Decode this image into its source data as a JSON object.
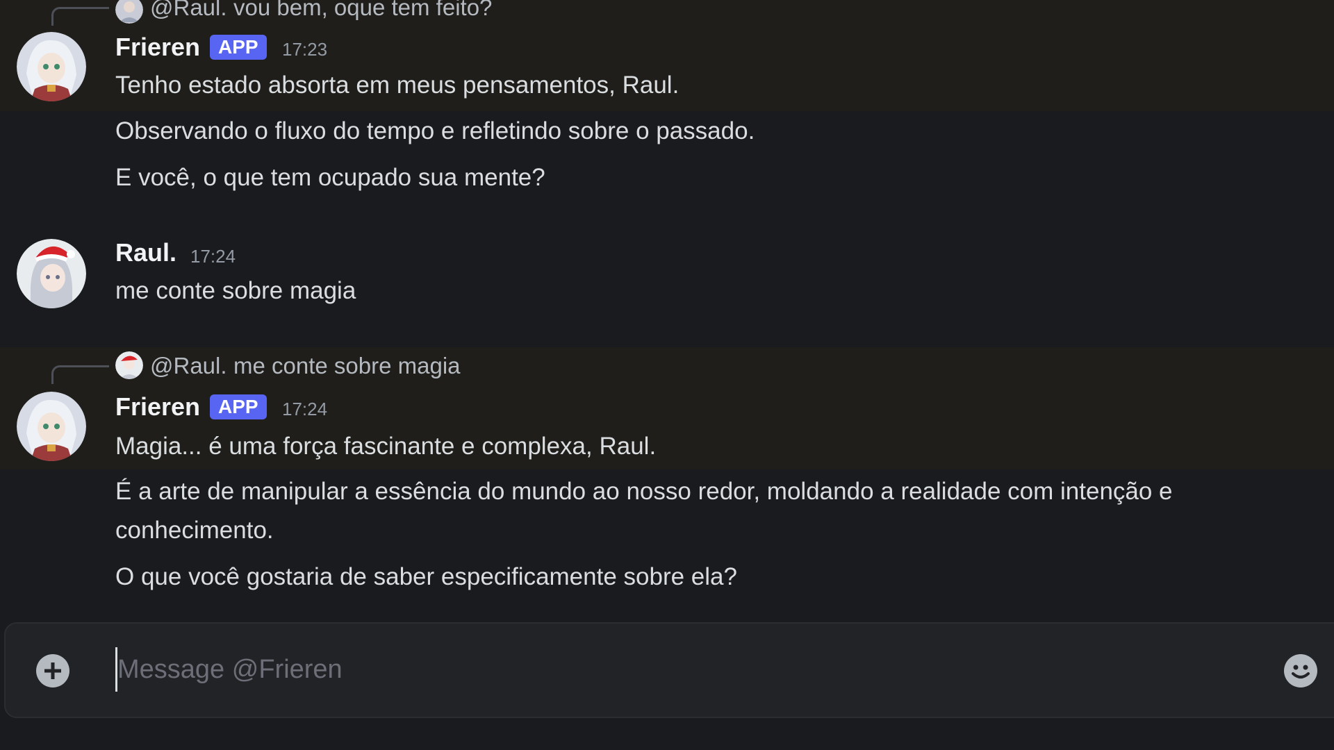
{
  "colors": {
    "background": "#1a1b1e",
    "highlight": "#1f1e1a",
    "badge": "#5865f2",
    "text": "#dbdee1",
    "muted": "#949ba4"
  },
  "messages": [
    {
      "reply": {
        "mention": "@Raul.",
        "text": "vou bem, oque tem feito?"
      },
      "author": "Frieren",
      "badge": "APP",
      "time": "17:23",
      "lines": [
        "Tenho estado absorta em meus pensamentos, Raul.",
        "Observando o fluxo do tempo e refletindo sobre o passado.",
        "E você, o que tem ocupado sua mente?"
      ]
    },
    {
      "author": "Raul.",
      "time": "17:24",
      "lines": [
        "me conte sobre magia"
      ]
    },
    {
      "reply": {
        "mention": "@Raul.",
        "text": "me conte sobre magia"
      },
      "author": "Frieren",
      "badge": "APP",
      "time": "17:24",
      "lines": [
        "Magia... é uma força fascinante e complexa, Raul.",
        "É a arte de manipular a essência do mundo ao nosso redor, moldando a realidade com intenção e conhecimento.",
        "O que você gostaria de saber especificamente sobre ela?"
      ]
    }
  ],
  "composer": {
    "placeholder": "Message @Frieren",
    "add_icon": "plus-circle-icon",
    "emoji_icon": "emoji-icon"
  }
}
